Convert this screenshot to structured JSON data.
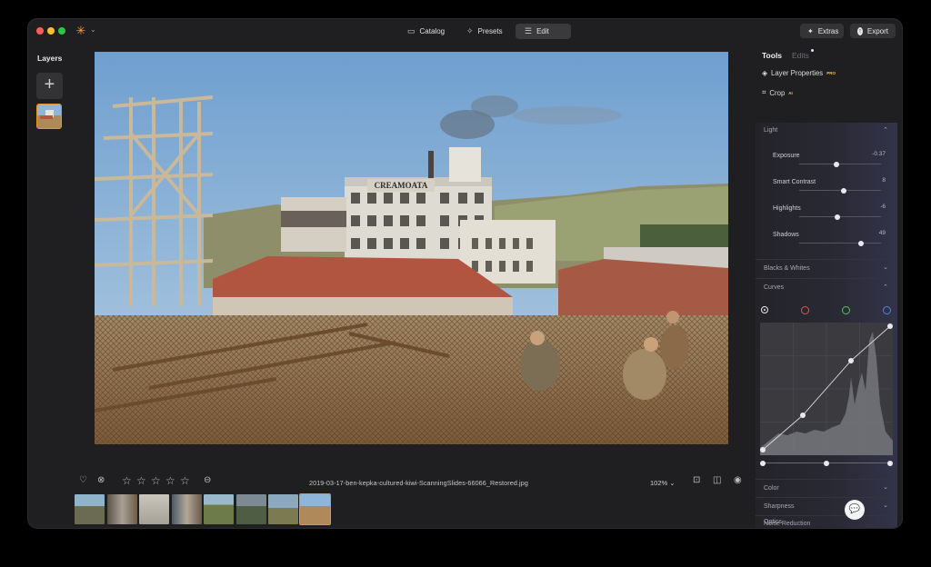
{
  "toolbar": {
    "catalog_label": "Catalog",
    "presets_label": "Presets",
    "edit_label": "Edit",
    "extras_label": "Extras",
    "export_label": "Export"
  },
  "layers": {
    "title": "Layers"
  },
  "photo": {
    "sign_text": "CREAMOATA"
  },
  "bottom": {
    "filename": "2019-03-17-ben-kepka-cultured-kiwi-ScanningSlides-66066_Restored.jpg",
    "zoom": "102%",
    "rating": 0,
    "rating_max": 5,
    "filmstrip_count": 8,
    "selected_index": 7
  },
  "panel": {
    "tabs": {
      "tools": "Tools",
      "edits": "Edits"
    },
    "layer_properties": "Layer Properties",
    "pro_badge": "PRO",
    "crop": "Crop",
    "ai_badge": "AI",
    "light": {
      "title": "Light",
      "sliders": [
        {
          "label": "Exposure",
          "value": "-0.37",
          "pos": 0.45
        },
        {
          "label": "Smart Contrast",
          "value": "8",
          "pos": 0.54
        },
        {
          "label": "Highlights",
          "value": "-6",
          "pos": 0.47
        },
        {
          "label": "Shadows",
          "value": "49",
          "pos": 0.75
        }
      ]
    },
    "blacks_whites": "Blacks & Whites",
    "curves": {
      "title": "Curves",
      "channels": [
        {
          "name": "luminance",
          "color": "#e8e8e8"
        },
        {
          "name": "red",
          "color": "#e0564a"
        },
        {
          "name": "green",
          "color": "#59c25b"
        },
        {
          "name": "blue",
          "color": "#4a86e0"
        }
      ]
    },
    "color": "Color",
    "sharpness": "Sharpness",
    "noise_reduction": "Noise Reduction",
    "optics": "Optics"
  },
  "colors": {
    "accent": "#e09a2c",
    "close": "#ff5f57",
    "minimize": "#febc2e",
    "zoom": "#28c840"
  }
}
